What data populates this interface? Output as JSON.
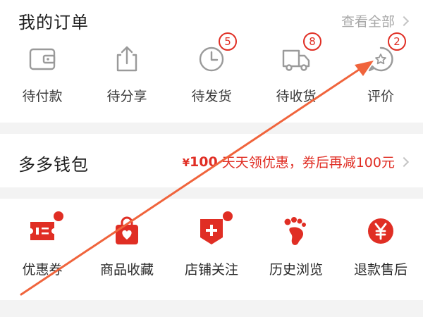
{
  "orders": {
    "title": "我的订单",
    "view_all": "查看全部",
    "items": [
      {
        "label": "待付款",
        "icon": "wallet-icon",
        "badge": null
      },
      {
        "label": "待分享",
        "icon": "share-icon",
        "badge": null
      },
      {
        "label": "待发货",
        "icon": "clock-icon",
        "badge": "5"
      },
      {
        "label": "待收货",
        "icon": "truck-icon",
        "badge": "8"
      },
      {
        "label": "评价",
        "icon": "review-icon",
        "badge": "2"
      }
    ]
  },
  "wallet": {
    "title": "多多钱包",
    "amount_symbol": "¥",
    "amount": "100",
    "promo": "天天领优惠，券后再减100元"
  },
  "tools": {
    "items": [
      {
        "label": "优惠券",
        "icon": "coupon-icon",
        "dot": true
      },
      {
        "label": "商品收藏",
        "icon": "heart-bag-icon",
        "dot": false
      },
      {
        "label": "店铺关注",
        "icon": "store-plus-icon",
        "dot": true
      },
      {
        "label": "历史浏览",
        "icon": "footprint-icon",
        "dot": false
      },
      {
        "label": "退款售后",
        "icon": "yen-circle-icon",
        "dot": false
      }
    ]
  },
  "colors": {
    "accent": "#e02e24",
    "icon_gray": "#9a9a9a",
    "annotation": "#f0643c"
  }
}
